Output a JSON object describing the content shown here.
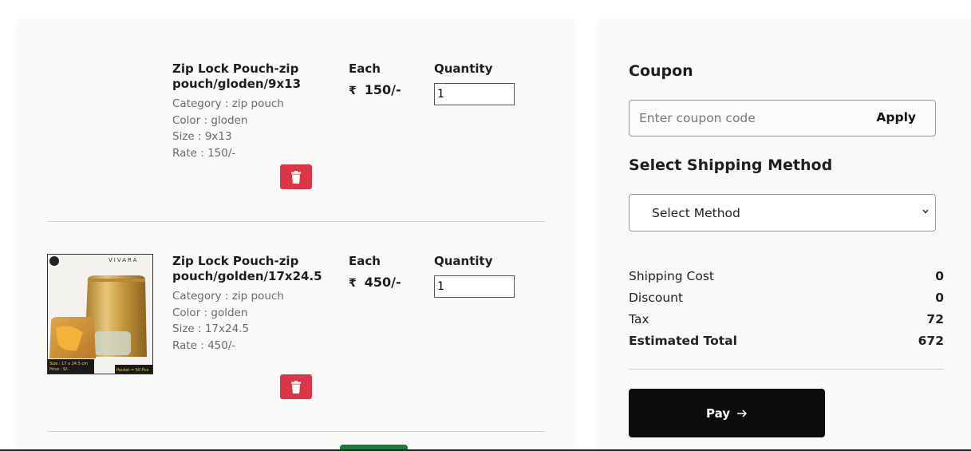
{
  "cart": {
    "items": [
      {
        "name": "Zip Lock Pouch-zip pouch/gloden/9x13",
        "category": "Category : zip pouch",
        "color": "Color : gloden",
        "size": "Size : 9x13",
        "rate": "Rate : 150/-",
        "each_label": "Each",
        "currency": "₹",
        "price": "150/-",
        "quantity_label": "Quantity",
        "quantity": "1",
        "has_image": false
      },
      {
        "name": "Zip Lock Pouch-zip pouch/golden/17x24.5",
        "category": "Category : zip pouch",
        "color": "Color : golden",
        "size": "Size : 17x24.5",
        "rate": "Rate : 450/-",
        "each_label": "Each",
        "currency": "₹",
        "price": "450/-",
        "quantity_label": "Quantity",
        "quantity": "1",
        "has_image": true,
        "image_text": {
          "brand": "VIVARA",
          "size_tag": "Size : 17 x 24.5 cm",
          "price_tag": "Price : 9/-",
          "packet_tag": "Packet = 50 Pcs"
        }
      }
    ],
    "delete_icon": "trash-icon"
  },
  "summary": {
    "coupon_title": "Coupon",
    "coupon_placeholder": "Enter coupon code",
    "apply_label": "Apply",
    "shipping_title": "Select Shipping Method",
    "shipping_select": "Select Method",
    "rows": {
      "shipping_cost_label": "Shipping Cost",
      "shipping_cost_value": "0",
      "discount_label": "Discount",
      "discount_value": "0",
      "tax_label": "Tax",
      "tax_value": "72",
      "total_label": "Estimated Total",
      "total_value": "672"
    },
    "pay_label": "Pay",
    "pay_icon": "arrow-right-icon"
  },
  "colors": {
    "delete_button": "#dc3545",
    "pay_button": "#0c0d0c",
    "green_button": "#1a7a3c",
    "panel_bg": "#f9f9f7"
  }
}
